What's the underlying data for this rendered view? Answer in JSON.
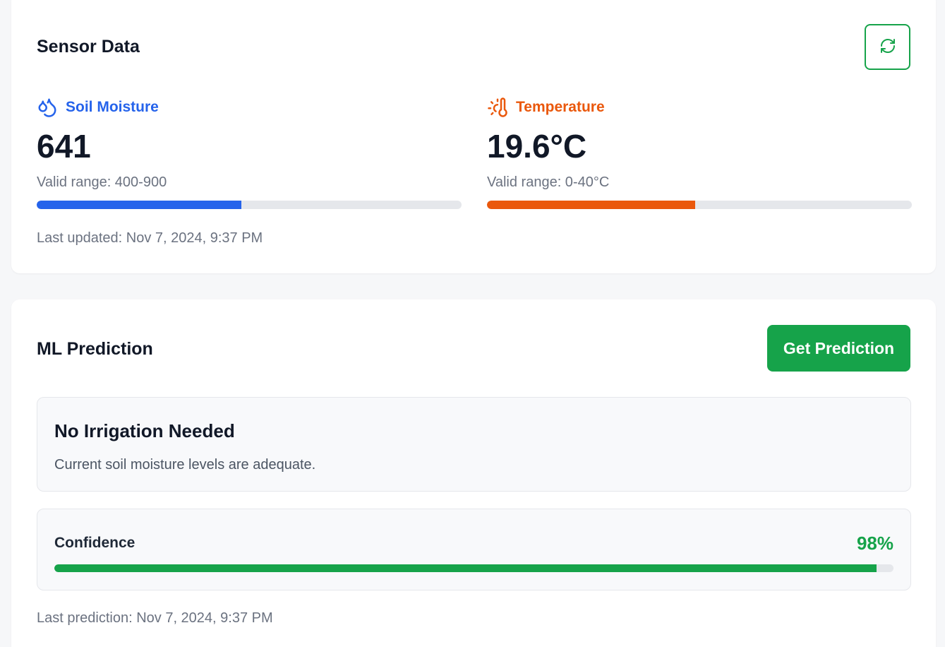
{
  "sensor": {
    "title": "Sensor Data",
    "refresh_icon": "refresh-icon",
    "soil": {
      "label": "Soil Moisture",
      "icon": "droplets-icon",
      "value": "641",
      "range": "Valid range: 400-900",
      "level_fraction": 0.482,
      "color": "#2563eb"
    },
    "temperature": {
      "label": "Temperature",
      "icon": "thermometer-sun-icon",
      "value": "19.6°C",
      "range": "Valid range: 0-40°C",
      "level_fraction": 0.49,
      "color": "#ea580c"
    },
    "last_updated": "Last updated: Nov 7, 2024, 9:37 PM"
  },
  "ml": {
    "title": "ML Prediction",
    "button_label": "Get Prediction",
    "result_title": "No Irrigation Needed",
    "result_desc": "Current soil moisture levels are adequate.",
    "confidence_label": "Confidence",
    "confidence_value": "98%",
    "confidence_fraction": 0.98,
    "last_prediction": "Last prediction: Nov 7, 2024, 9:37 PM"
  },
  "colors": {
    "accent_green": "#16a34a",
    "track": "#e5e7eb"
  }
}
